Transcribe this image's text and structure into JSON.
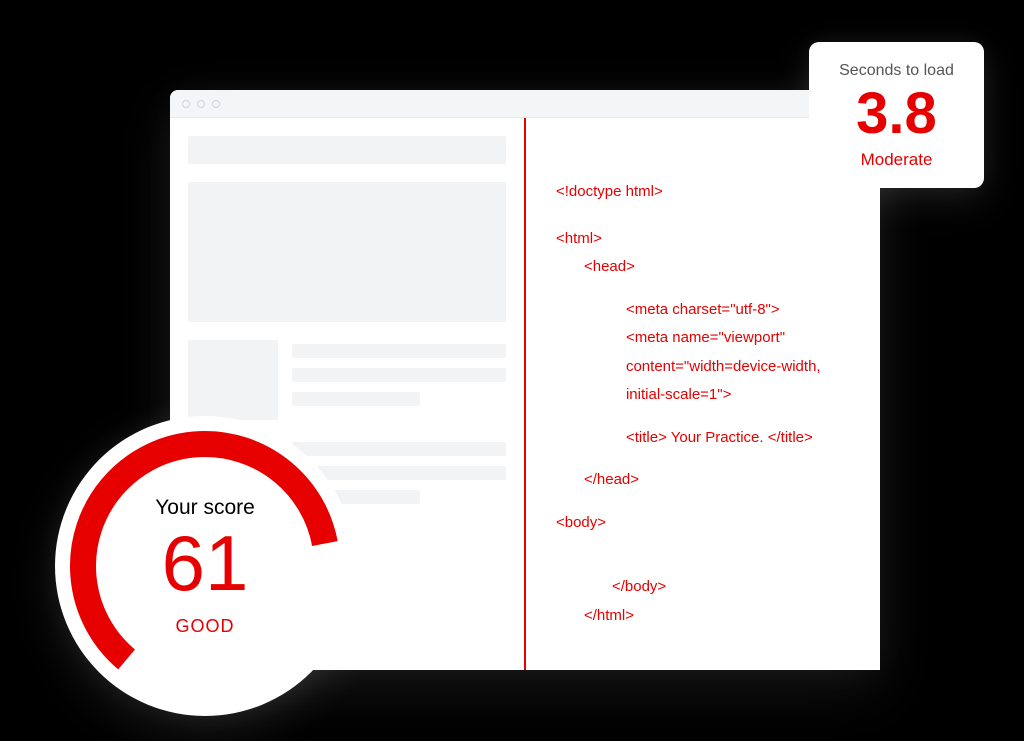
{
  "score": {
    "label": "Your score",
    "value": "61",
    "rating": "GOOD"
  },
  "load": {
    "label": "Seconds to load",
    "value": "3.8",
    "rating": "Moderate"
  },
  "code": {
    "doctype": "<!doctype html>",
    "html_open": "<html>",
    "head_open": "<head>",
    "meta_charset": "<meta charset=\"utf-8\">",
    "meta_viewport1": "<meta name=\"viewport\"",
    "meta_viewport2": "content=\"width=device-width,",
    "meta_viewport3": "initial-scale=1\">",
    "title": "<title> Your Practice. </title>",
    "head_close": "</head>",
    "body_open": "<body>",
    "body_close": "</body>",
    "html_close": "</html>"
  },
  "colors": {
    "accent": "#e60000",
    "placeholder": "#f1f3f5"
  }
}
